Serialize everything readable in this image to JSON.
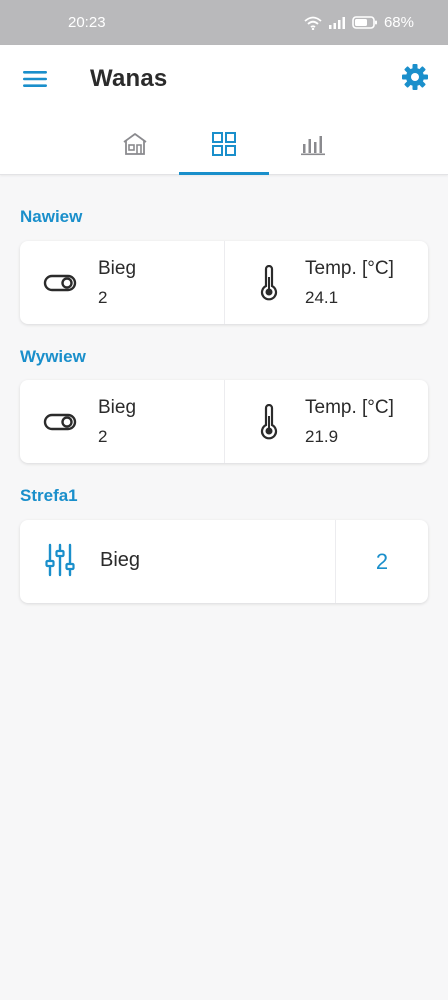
{
  "status_bar": {
    "time": "20:23",
    "battery": "68%",
    "icons": [
      "wifi-icon",
      "signal-icon",
      "battery-icon"
    ]
  },
  "app_bar": {
    "title": "Wanas",
    "menu_icon": "hamburger-menu-icon",
    "settings_icon": "gear-icon"
  },
  "tabs": [
    {
      "icon": "house-icon",
      "active": false
    },
    {
      "icon": "grid-icon",
      "active": true
    },
    {
      "icon": "bar-chart-icon",
      "active": false
    }
  ],
  "sections": [
    {
      "title": "Nawiew",
      "cells": [
        {
          "icon": "toggle-icon",
          "label": "Bieg",
          "value": "2"
        },
        {
          "icon": "thermometer-icon",
          "label": "Temp. [°C]",
          "value": "24.1"
        }
      ]
    },
    {
      "title": "Wywiew",
      "cells": [
        {
          "icon": "toggle-icon",
          "label": "Bieg",
          "value": "2"
        },
        {
          "icon": "thermometer-icon",
          "label": "Temp. [°C]",
          "value": "21.9"
        }
      ]
    },
    {
      "title": "Strefa1",
      "control": {
        "icon": "sliders-icon",
        "label": "Bieg",
        "value": "2"
      }
    }
  ],
  "colors": {
    "accent": "#1a8fcb",
    "status_bar": "#b9b9bb",
    "background": "#f7f7f8"
  }
}
